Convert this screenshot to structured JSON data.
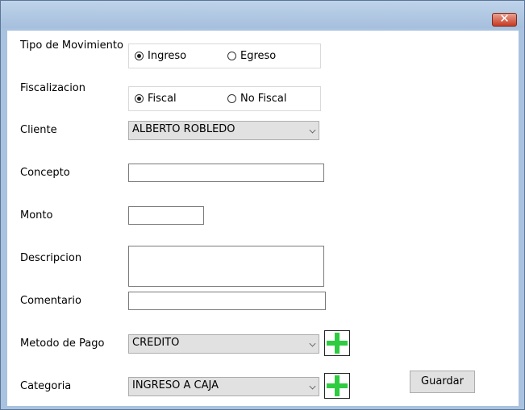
{
  "window": {
    "close_label": "✕"
  },
  "form": {
    "tipo_label": "Tipo de Movimiento",
    "tipo_options": [
      "Ingreso",
      "Egreso"
    ],
    "tipo_selected": "Ingreso",
    "fiscal_label": "Fiscalizacion",
    "fiscal_options": [
      "Fiscal",
      "No Fiscal"
    ],
    "fiscal_selected": "Fiscal",
    "cliente_label": "Cliente",
    "cliente_value": "ALBERTO ROBLEDO",
    "concepto_label": "Concepto",
    "concepto_value": "",
    "monto_label": "Monto",
    "monto_value": "",
    "descripcion_label": "Descripcion",
    "descripcion_value": "",
    "comentario_label": "Comentario",
    "comentario_value": "",
    "metodo_label": "Metodo de Pago",
    "metodo_value": "CREDITO",
    "categoria_label": "Categoria",
    "categoria_value": "INGRESO A CAJA",
    "guardar_label": "Guardar"
  },
  "colors": {
    "title_bar": "#a9c2df",
    "close_button": "#c63a24",
    "add_icon": "#2ecc40",
    "combo_bg": "#e1e1e1"
  }
}
